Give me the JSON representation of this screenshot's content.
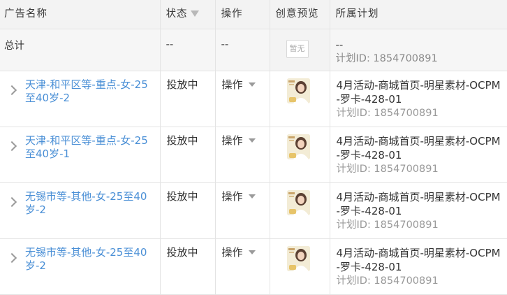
{
  "columns": {
    "name": "广告名称",
    "status": "状态",
    "action": "操作",
    "preview": "创意预览",
    "plan": "所属计划"
  },
  "total": {
    "label": "总计",
    "status": "--",
    "action": "--",
    "preview": "暂无",
    "plan_name": "--",
    "plan_id": "计划ID: 1854700891"
  },
  "rows": [
    {
      "name": "天津-和平区等-重点-女-25至40岁-2",
      "status": "投放中",
      "action": "操作",
      "plan_name": "4月活动-商城首页-明星素材-OCPM-罗卡-428-01",
      "plan_id": "计划ID: 1854700891"
    },
    {
      "name": "天津-和平区等-重点-女-25至40岁-1",
      "status": "投放中",
      "action": "操作",
      "plan_name": "4月活动-商城首页-明星素材-OCPM-罗卡-428-01",
      "plan_id": "计划ID: 1854700891"
    },
    {
      "name": "无锡市等-其他-女-25至40岁-2",
      "status": "投放中",
      "action": "操作",
      "plan_name": "4月活动-商城首页-明星素材-OCPM-罗卡-428-01",
      "plan_id": "计划ID: 1854700891"
    },
    {
      "name": "无锡市等-其他-女-25至40岁-2",
      "status": "投放中",
      "action": "操作",
      "plan_name": "4月活动-商城首页-明星素材-OCPM-罗卡-428-01",
      "plan_id": "计划ID: 1854700891"
    }
  ],
  "icons": {
    "expand": "chevron-right-icon",
    "filter": "filter-icon",
    "dropdown": "caret-down-icon"
  },
  "colors": {
    "link": "#4a8fd6",
    "header_bg": "#f3f3f3",
    "muted": "#9a9a9a"
  }
}
